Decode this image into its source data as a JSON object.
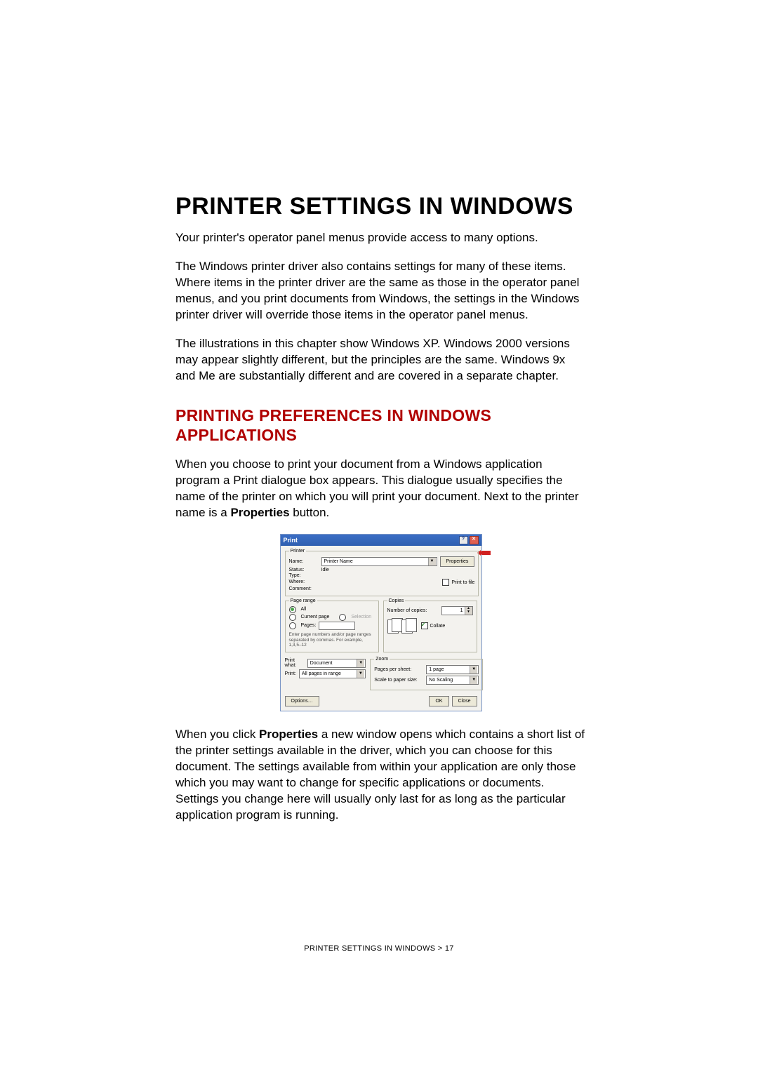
{
  "title": "PRINTER SETTINGS IN WINDOWS",
  "paragraphs": {
    "p1": "Your printer's operator panel menus provide access to many options.",
    "p2": "The Windows printer driver also contains settings for many of these items. Where items in the printer driver are the same as those in the operator panel menus, and you print documents from Windows, the settings in the Windows printer driver will override those items in the operator panel menus.",
    "p3": "The illustrations in this chapter show Windows XP.  Windows 2000 versions may appear slightly different, but the principles are the same. Windows 9x and Me  are substantially different and are covered in  a separate chapter."
  },
  "subheading": "PRINTING PREFERENCES IN WINDOWS APPLICATIONS",
  "paragraphs2": {
    "p4": "When you choose to print your document from a Windows application program a Print dialogue box appears. This dialogue usually specifies the name of the printer on which you will print your document. Next to the printer name is a ",
    "p4_bold": "Properties",
    "p4_tail": " button.",
    "p5_a": "When you click ",
    "p5_bold": "Properties",
    "p5_b": " a new window opens which contains a short list of the printer settings available in the driver, which you can choose for this document. The settings available from within your application are only those which you may want to change for specific applications or documents. Settings you change here will usually only last for as long as the particular application program is running."
  },
  "dialog": {
    "title": "Print",
    "help_glyph": "?",
    "close_glyph": "✕",
    "printer_group": "Printer",
    "name_label": "Name:",
    "name_value": "Printer Name",
    "status_label": "Status:",
    "status_value": "Idle",
    "type_label": "Type:",
    "where_label": "Where:",
    "comment_label": "Comment:",
    "properties_btn": "Properties",
    "print_to_file": "Print to file",
    "page_range_group": "Page range",
    "all": "All",
    "current_page": "Current page",
    "selection": "Selection",
    "pages": "Pages:",
    "pages_hint": "Enter page numbers and/or page ranges separated by commas. For example, 1,3,5–12",
    "copies_group": "Copies",
    "num_copies": "Number of copies:",
    "num_copies_val": "1",
    "collate": "Collate",
    "print_what": "Print what:",
    "print_what_val": "Document",
    "print_label": "Print:",
    "print_val": "All pages in range",
    "zoom_group": "Zoom",
    "pages_per_sheet": "Pages per sheet:",
    "pages_per_sheet_val": "1 page",
    "scale": "Scale to paper size:",
    "scale_val": "No Scaling",
    "options_btn": "Options…",
    "ok_btn": "OK",
    "close_btn": "Close"
  },
  "footer": "PRINTER SETTINGS IN WINDOWS > 17"
}
